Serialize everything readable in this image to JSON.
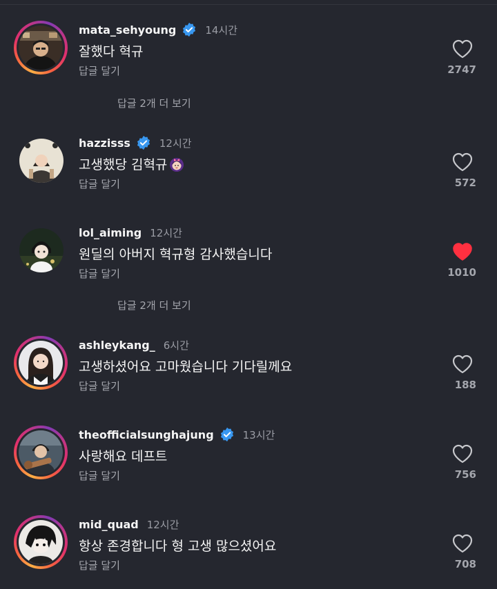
{
  "colors": {
    "background": "#25272f",
    "verified_blue": "#3897f0",
    "liked_red": "#ff3040",
    "muted_text": "#a4a6ad"
  },
  "comments": [
    {
      "username": "mata_sehyoung",
      "verified": true,
      "time": "14시간",
      "text": "잘했다 혁규",
      "reply_label": "답글 달기",
      "likes": "2747",
      "liked": false,
      "has_story": true,
      "view_replies": "답글 2개 더 보기"
    },
    {
      "username": "hazzisss",
      "verified": true,
      "time": "12시간",
      "text": "고생했당 김혁규",
      "emoji": "face-with-bow-emoji",
      "reply_label": "답글 달기",
      "likes": "572",
      "liked": false,
      "has_story": false
    },
    {
      "username": "lol_aiming",
      "verified": false,
      "time": "12시간",
      "text": "원딜의 아버지 혁규형 감사했습니다",
      "reply_label": "답글 달기",
      "likes": "1010",
      "liked": true,
      "has_story": false,
      "view_replies": "답글 2개 더 보기"
    },
    {
      "username": "ashleykang_",
      "verified": false,
      "time": "6시간",
      "text": "고생하셨어요 고마웠습니다 기다릴께요",
      "reply_label": "답글 달기",
      "likes": "188",
      "liked": false,
      "has_story": true
    },
    {
      "username": "theofficialsunghajung",
      "verified": true,
      "time": "13시간",
      "text": "사랑해요 데프트",
      "reply_label": "답글 달기",
      "likes": "756",
      "liked": false,
      "has_story": true
    },
    {
      "username": "mid_quad",
      "verified": false,
      "time": "12시간",
      "text": "항상 존경합니다 형 고생 많으셨어요",
      "reply_label": "답글 달기",
      "likes": "708",
      "liked": false,
      "has_story": true
    }
  ]
}
